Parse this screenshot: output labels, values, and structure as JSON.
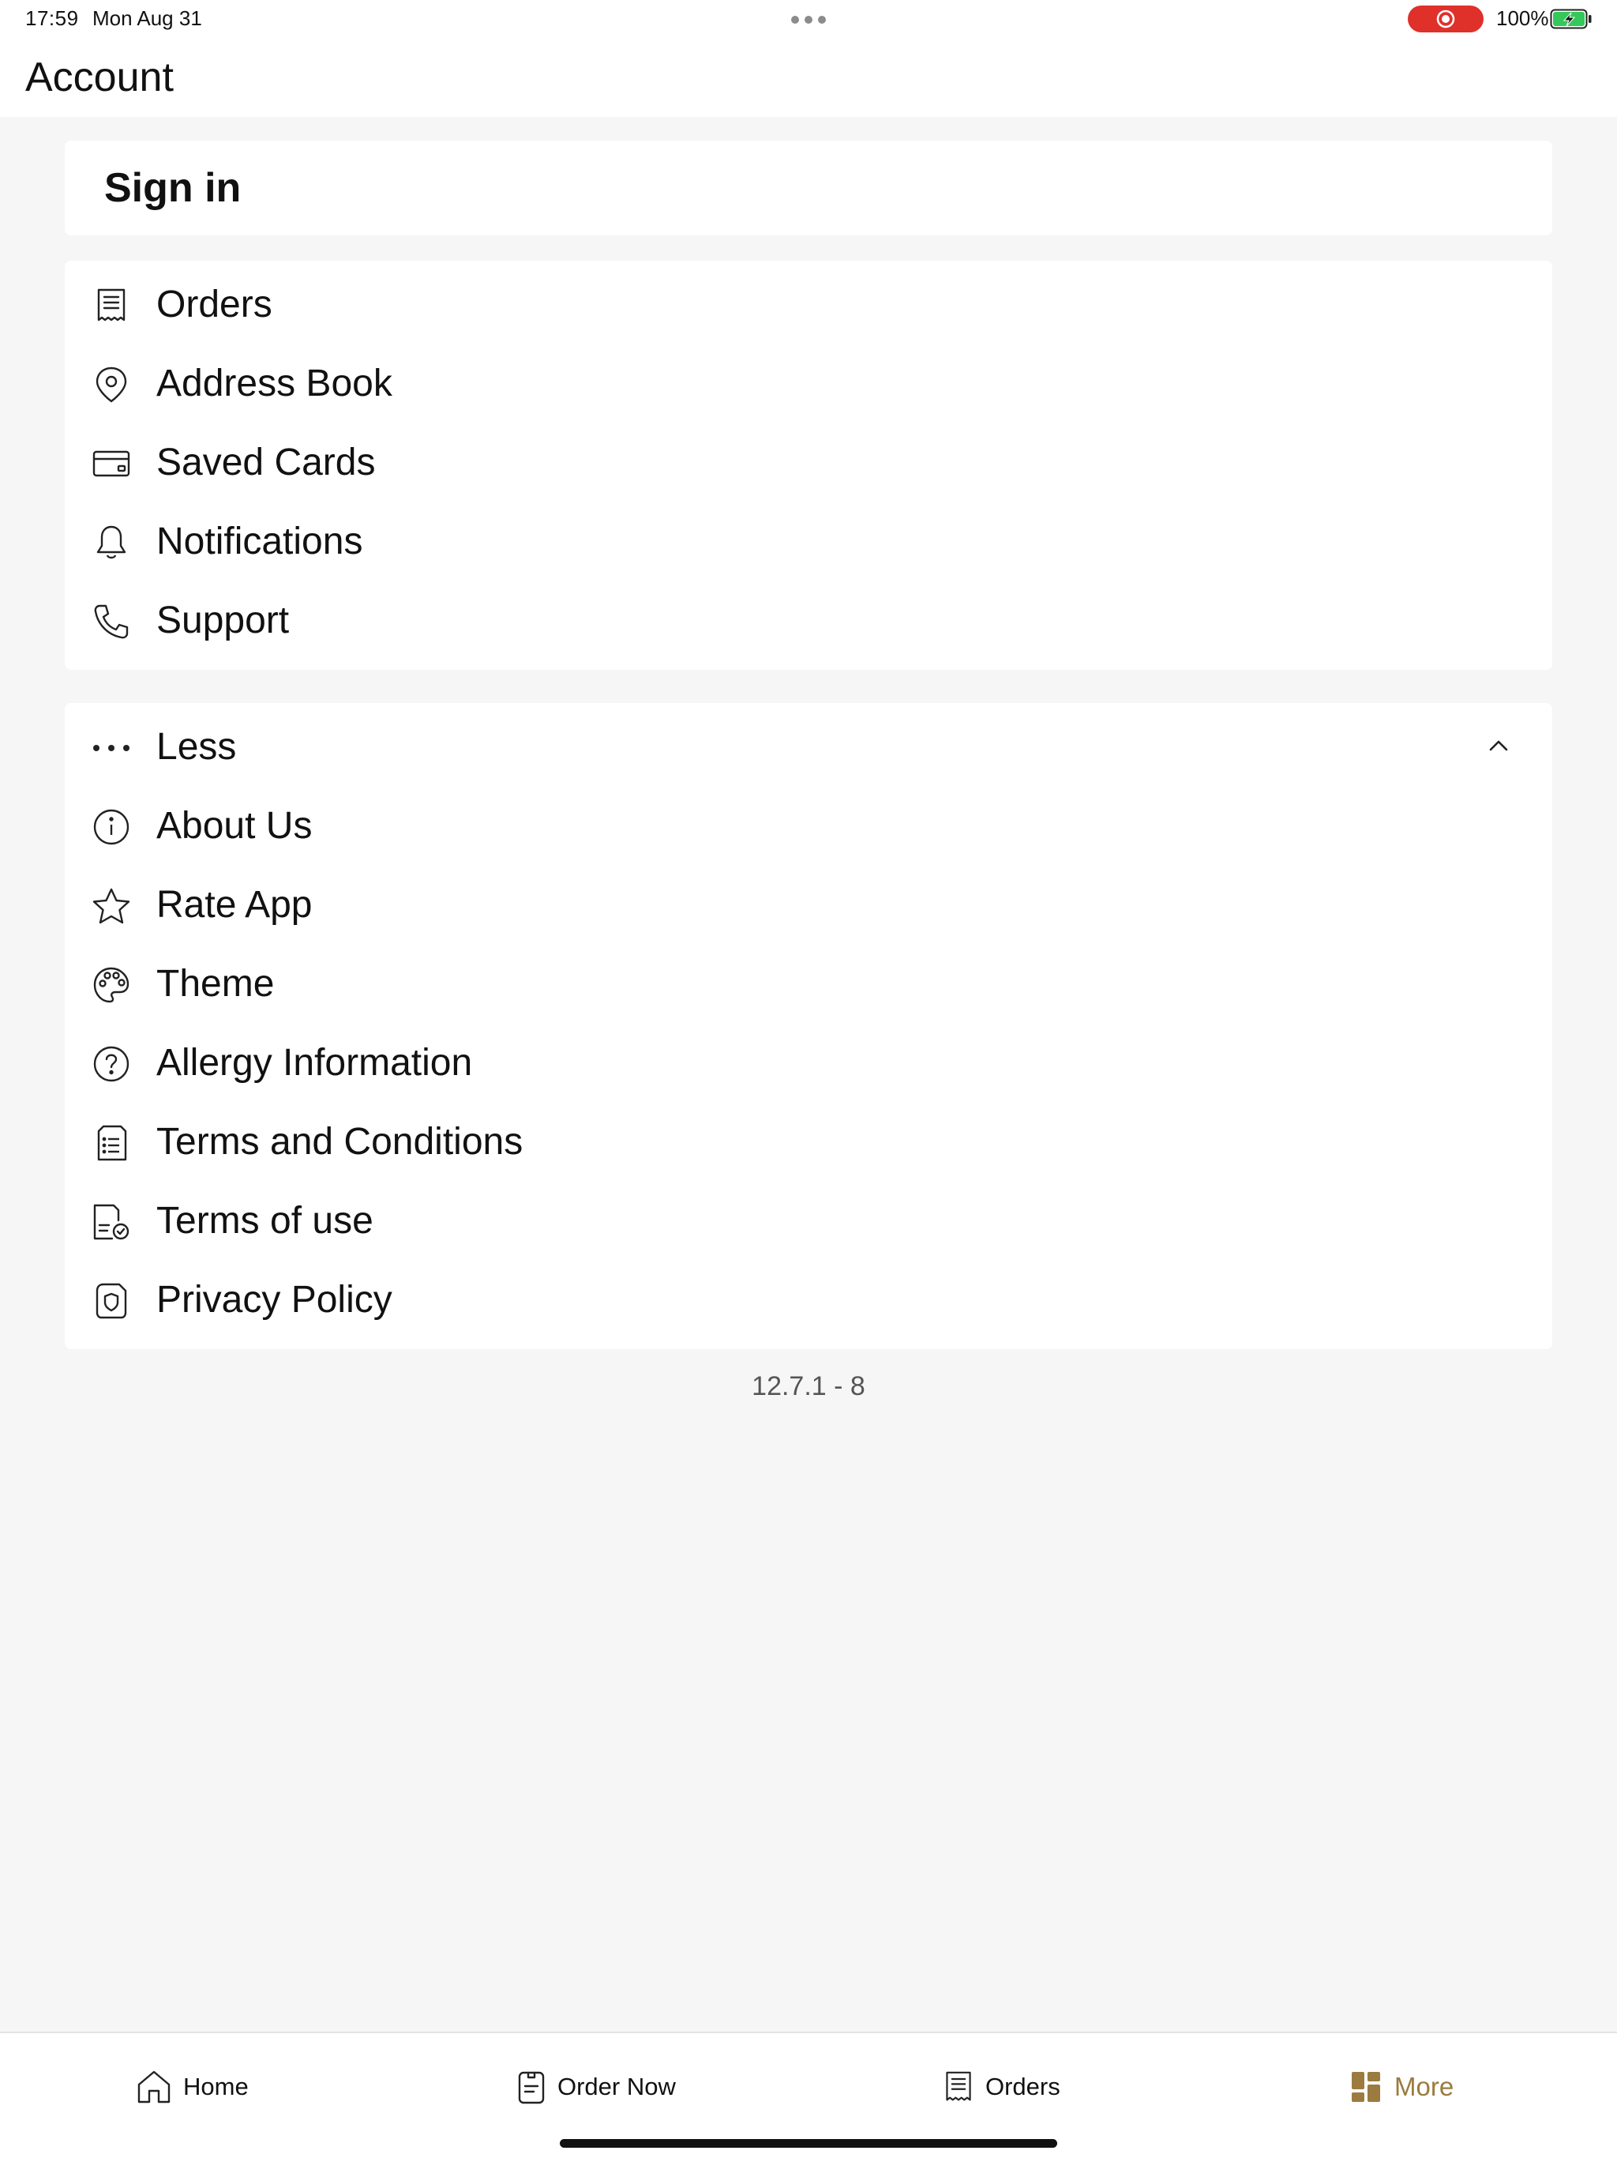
{
  "status_bar": {
    "time": "17:59",
    "date": "Mon Aug 31",
    "battery": "100%",
    "record_color": "#e0302a",
    "battery_color": "#34c759"
  },
  "header": {
    "title": "Account"
  },
  "signin": {
    "label": "Sign in"
  },
  "menu": {
    "items": [
      {
        "label": "Orders",
        "icon": "receipt-icon"
      },
      {
        "label": "Address Book",
        "icon": "location-pin-icon"
      },
      {
        "label": "Saved Cards",
        "icon": "credit-card-icon"
      },
      {
        "label": "Notifications",
        "icon": "bell-icon"
      },
      {
        "label": "Support",
        "icon": "phone-icon"
      }
    ]
  },
  "more": {
    "toggle_label": "Less",
    "items": [
      {
        "label": "About Us",
        "icon": "info-icon"
      },
      {
        "label": "Rate App",
        "icon": "star-icon"
      },
      {
        "label": "Theme",
        "icon": "palette-icon"
      },
      {
        "label": "Allergy Information",
        "icon": "question-icon"
      },
      {
        "label": "Terms and Conditions",
        "icon": "document-list-icon"
      },
      {
        "label": "Terms of use",
        "icon": "document-check-icon"
      },
      {
        "label": "Privacy Policy",
        "icon": "shield-document-icon"
      }
    ]
  },
  "version": "12.7.1 - 8",
  "tabbar": {
    "accent_color": "#9b7b3f",
    "tabs": [
      {
        "label": "Home",
        "icon": "home-icon"
      },
      {
        "label": "Order Now",
        "icon": "order-now-icon"
      },
      {
        "label": "Orders",
        "icon": "receipt-icon"
      },
      {
        "label": "More",
        "icon": "grid-icon",
        "active": true
      }
    ]
  }
}
